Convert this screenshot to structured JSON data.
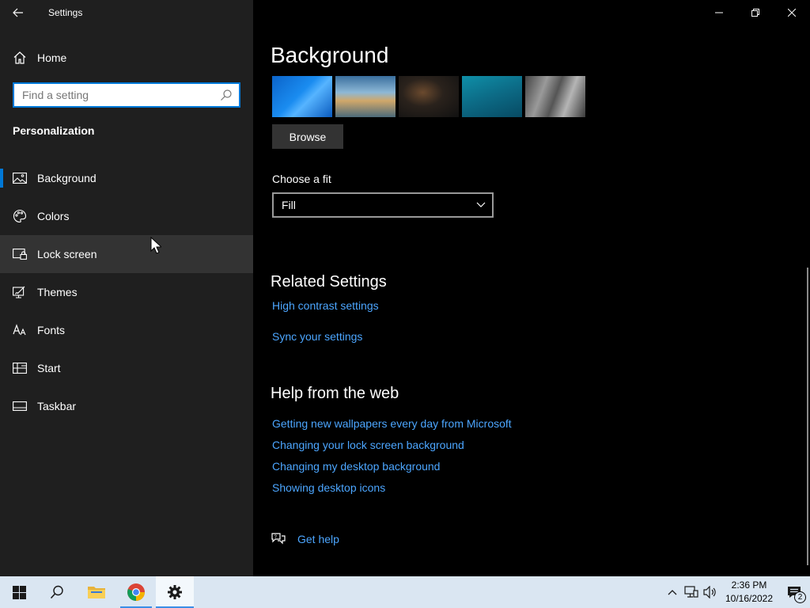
{
  "window": {
    "title": "Settings"
  },
  "sidebar": {
    "home_label": "Home",
    "search_placeholder": "Find a setting",
    "section_title": "Personalization",
    "items": [
      {
        "label": "Background",
        "icon": "picture-icon",
        "selected": true
      },
      {
        "label": "Colors",
        "icon": "palette-icon"
      },
      {
        "label": "Lock screen",
        "icon": "lock-screen-icon",
        "hover": true
      },
      {
        "label": "Themes",
        "icon": "brush-icon"
      },
      {
        "label": "Fonts",
        "icon": "fonts-icon"
      },
      {
        "label": "Start",
        "icon": "start-icon"
      },
      {
        "label": "Taskbar",
        "icon": "taskbar-icon"
      }
    ]
  },
  "main": {
    "page_title": "Background",
    "browse_label": "Browse",
    "fit_label": "Choose a fit",
    "fit_value": "Fill",
    "related": {
      "title": "Related Settings",
      "links": [
        "High contrast settings",
        "Sync your settings"
      ]
    },
    "help": {
      "title": "Help from the web",
      "links": [
        "Getting new wallpapers every day from Microsoft",
        "Changing your lock screen background",
        "Changing my desktop background",
        "Showing desktop icons"
      ]
    },
    "get_help_label": "Get help"
  },
  "taskbar": {
    "clock_time": "2:36 PM",
    "clock_date": "10/16/2022",
    "notification_count": "2"
  },
  "colors": {
    "accent": "#0078d7",
    "link": "#4ca6ff",
    "sidebar_bg": "#1f1f1f",
    "main_bg": "#000000",
    "taskbar_bg": "#dae6f2"
  }
}
